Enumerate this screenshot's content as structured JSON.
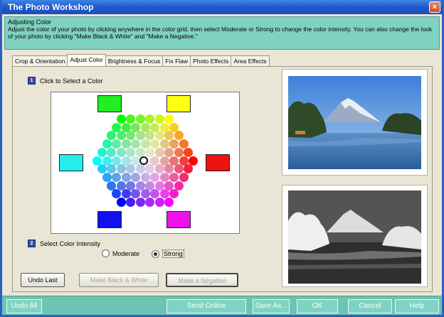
{
  "window": {
    "title": "The Photo Workshop",
    "close_glyph": "×"
  },
  "info": {
    "heading": "Adjusting Color",
    "description": "Adjust the color of your photo by clicking anywhere in the color grid, then select Moderate or Strong to change the color intensity.  You can also change the look of your photo by clicking \"Make Black & White\" and \"Make a Negative.\""
  },
  "tabs": [
    {
      "label": "Crop & Orientation",
      "active": false
    },
    {
      "label": "Adjust Color",
      "active": true
    },
    {
      "label": "Brightness & Focus",
      "active": false
    },
    {
      "label": "Fix Flaw",
      "active": false
    },
    {
      "label": "Photo Effects",
      "active": false
    },
    {
      "label": "Area Effects",
      "active": false
    }
  ],
  "color_section": {
    "step": "1",
    "label": "Click to Select a Color"
  },
  "swatches": {
    "top_left": "#22ee22",
    "top_right": "#ffff11",
    "left": "#22eeee",
    "right": "#ee1111",
    "bottom_left": "#1111ee",
    "bottom_right": "#ee11ee"
  },
  "intensity": {
    "step": "2",
    "label": "Select Color Intensity",
    "options": [
      {
        "label": "Moderate",
        "selected": false
      },
      {
        "label": "Strong",
        "selected": true
      }
    ]
  },
  "actions": {
    "undo_last": "Undo Last",
    "black_white": "Make Black & White",
    "negative": "Make a Negative"
  },
  "bottom": {
    "undo_all": "Undo All",
    "send_online": "Send Online",
    "save_as": "Save As...",
    "ok": "OK",
    "cancel": "Cancel",
    "help": "Help"
  },
  "colors": {
    "title_bar": "#1f57c8",
    "info_panel": "#7fd1c0",
    "bottom_bar": "#6cc4b2",
    "panel": "#eae6d5"
  },
  "icons": [
    "close-icon",
    "step-number-icon",
    "color-hexagon-grid",
    "radio-icon",
    "landscape-photo",
    "photo-preview-negative"
  ]
}
